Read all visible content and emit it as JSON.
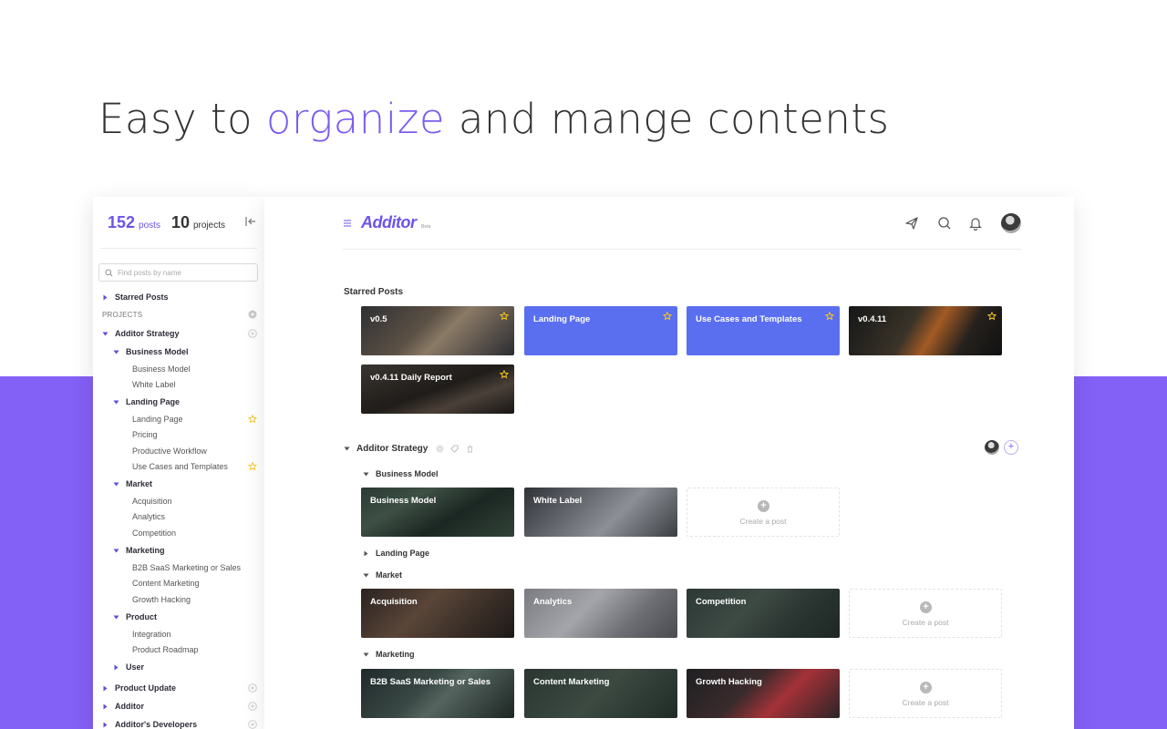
{
  "hero": {
    "prefix": "Easy to ",
    "accent": "organize",
    "suffix": " and mange contents"
  },
  "colors": {
    "accent": "#7b5cf0",
    "band": "#8360f6",
    "card_blue": "#5a6ff0",
    "star": "#f5c518"
  },
  "sidebar": {
    "posts_count": "152",
    "posts_label": "posts",
    "projects_count": "10",
    "projects_label": "projects",
    "search_placeholder": "Find posts by name",
    "starred": "Starred Posts",
    "projects_header": "PROJECTS",
    "tree": {
      "additor_strategy": "Additor Strategy",
      "business_model": "Business Model",
      "business_model_item": "Business Model",
      "white_label": "White Label",
      "landing_page": "Landing Page",
      "landing_page_item": "Landing Page",
      "pricing": "Pricing",
      "productive_workflow": "Productive Workflow",
      "use_cases": "Use Cases and Templates",
      "market": "Market",
      "acquisition": "Acquisition",
      "analytics": "Analytics",
      "competition": "Competition",
      "marketing": "Marketing",
      "b2b": "B2B SaaS Marketing or Sales",
      "content_marketing": "Content Marketing",
      "growth_hacking": "Growth Hacking",
      "product": "Product",
      "integration": "Integration",
      "product_roadmap": "Product Roadmap",
      "user": "User",
      "product_update": "Product Update",
      "additor": "Additor",
      "developers": "Additor's Developers"
    }
  },
  "app": {
    "logo": "Additor",
    "beta": "Beta"
  },
  "starred": {
    "title": "Starred Posts",
    "cards": [
      "v0.5",
      "Landing Page",
      "Use Cases and Templates",
      "v0.4.11",
      "v0.4.11 Daily Report"
    ]
  },
  "strategy": {
    "title": "Additor Strategy",
    "business_model": {
      "title": "Business Model",
      "cards": [
        "Business Model",
        "White Label"
      ]
    },
    "landing_page": {
      "title": "Landing Page"
    },
    "market": {
      "title": "Market",
      "cards": [
        "Acquisition",
        "Analytics",
        "Competition"
      ]
    },
    "marketing": {
      "title": "Marketing",
      "cards": [
        "B2B SaaS Marketing or Sales",
        "Content Marketing",
        "Growth Hacking"
      ]
    },
    "create_label": "Create a post"
  }
}
